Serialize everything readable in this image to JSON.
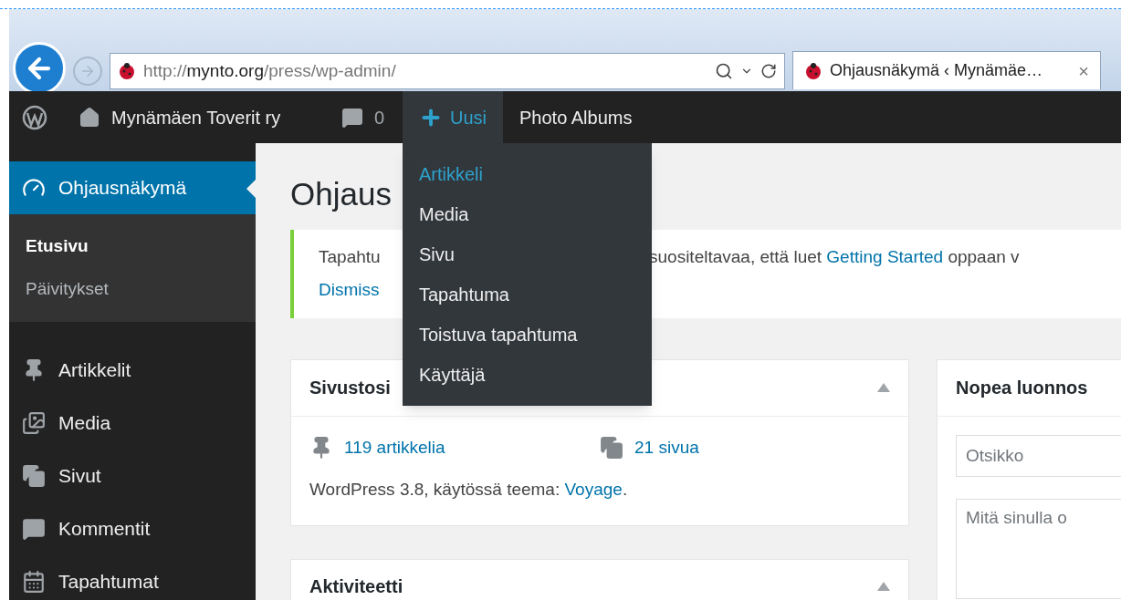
{
  "browser": {
    "url_scheme": "http://",
    "url_domain": "mynto.org",
    "url_path": "/press/wp-admin/",
    "tab_title": "Ohjausnäkymä ‹ Mynämäe…",
    "tab_close": "×"
  },
  "admin_bar": {
    "site_name": "Mynämäen Toverit ry",
    "comments": "0",
    "new_label": "Uusi",
    "new_expanded": true,
    "links": [
      "Photo Albums"
    ]
  },
  "new_menu": [
    {
      "label": "Artikkeli",
      "selected": true
    },
    {
      "label": "Media",
      "selected": false
    },
    {
      "label": "Sivu",
      "selected": false
    },
    {
      "label": "Tapahtuma",
      "selected": false
    },
    {
      "label": "Toistuva tapahtuma",
      "selected": false
    },
    {
      "label": "Käyttäjä",
      "selected": false
    }
  ],
  "sidebar": {
    "items": [
      {
        "label": "Ohjausnäkymä",
        "kind": "dashboard",
        "selected": true,
        "children": [
          {
            "label": "Etusivu",
            "selected": true
          },
          {
            "label": "Päivitykset",
            "selected": false
          }
        ]
      },
      {
        "label": "Artikkelit",
        "kind": "pin",
        "selected": false
      },
      {
        "label": "Media",
        "kind": "media",
        "selected": false
      },
      {
        "label": "Sivut",
        "kind": "pages",
        "selected": false
      },
      {
        "label": "Kommentit",
        "kind": "comments",
        "selected": false
      },
      {
        "label": "Tapahtumat",
        "kind": "calendar",
        "selected": false
      }
    ]
  },
  "page_title": "Ohjaus",
  "notice": {
    "lead": "Tapahtu",
    "text_before": "suositeltavaa, että luet ",
    "link": "Getting Started",
    "text_after": " oppaan v",
    "dismiss": "Dismiss"
  },
  "glance": {
    "title": "Sivustosi",
    "stats": [
      {
        "kind": "pin",
        "label": "119 artikkelia"
      },
      {
        "kind": "pages",
        "label": "21 sivua"
      }
    ],
    "footer_before": "WordPress 3.8, käytössä teema: ",
    "theme_link": "Voyage",
    "footer_after": "."
  },
  "quick_draft": {
    "title": "Nopea luonnos",
    "title_placeholder": "Otsikko",
    "content_placeholder": "Mitä sinulla o"
  },
  "activity": {
    "title": "Aktiviteetti"
  }
}
